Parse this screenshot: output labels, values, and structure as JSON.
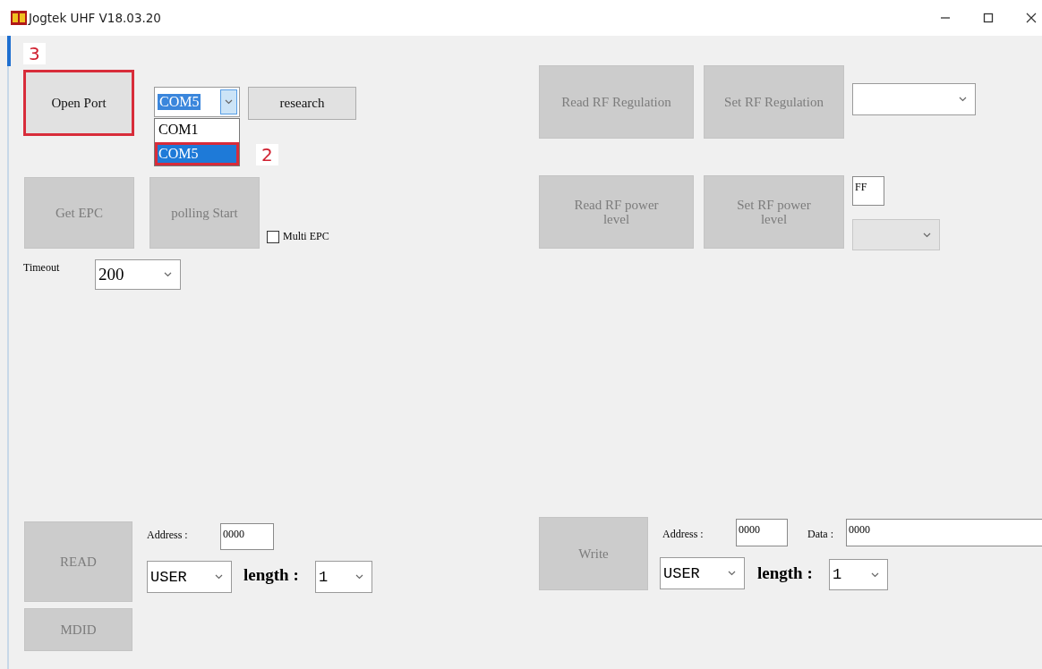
{
  "window": {
    "title": "Jogtek UHF V18.03.20"
  },
  "port": {
    "open_button": {
      "label": "Open Port",
      "disabled": false,
      "annotation": "3"
    },
    "port_combo": {
      "value": "COM5",
      "expanded": true,
      "options": [
        {
          "label": "COM1",
          "selected": false
        },
        {
          "label": "COM5",
          "selected": true,
          "annotation": "2"
        }
      ]
    },
    "research_button": {
      "label": "research",
      "disabled": false
    }
  },
  "epc": {
    "get_button": {
      "label": "Get EPC",
      "disabled": true
    },
    "polling_button": {
      "label": "polling Start",
      "disabled": true
    },
    "multi_epc": {
      "label": "Multi EPC",
      "checked": false
    },
    "timeout_label": "Timeout",
    "timeout_value": "200"
  },
  "rf": {
    "read_regulation": {
      "label": "Read RF Regulation",
      "disabled": true
    },
    "set_regulation": {
      "label": "Set RF Regulation",
      "disabled": true
    },
    "regulation_combo": {
      "disabled": false
    },
    "read_power": {
      "label": "Read RF power level",
      "disabled": true
    },
    "set_power": {
      "label": "Set RF power level",
      "disabled": true
    },
    "power_value": "FF",
    "power_combo": {
      "disabled": true
    }
  },
  "read": {
    "button": {
      "label": "READ",
      "disabled": true
    },
    "address_label": "Address :",
    "address": "0000",
    "bank": "USER",
    "length_label": "length :",
    "length": "1",
    "mdid_button": {
      "label": "MDID",
      "disabled": true
    }
  },
  "write": {
    "button": {
      "label": "Write",
      "disabled": true
    },
    "address_label": "Address :",
    "address": "0000",
    "data_label": "Data :",
    "data": "0000",
    "bank": "USER",
    "length_label": "length :",
    "length": "1"
  }
}
